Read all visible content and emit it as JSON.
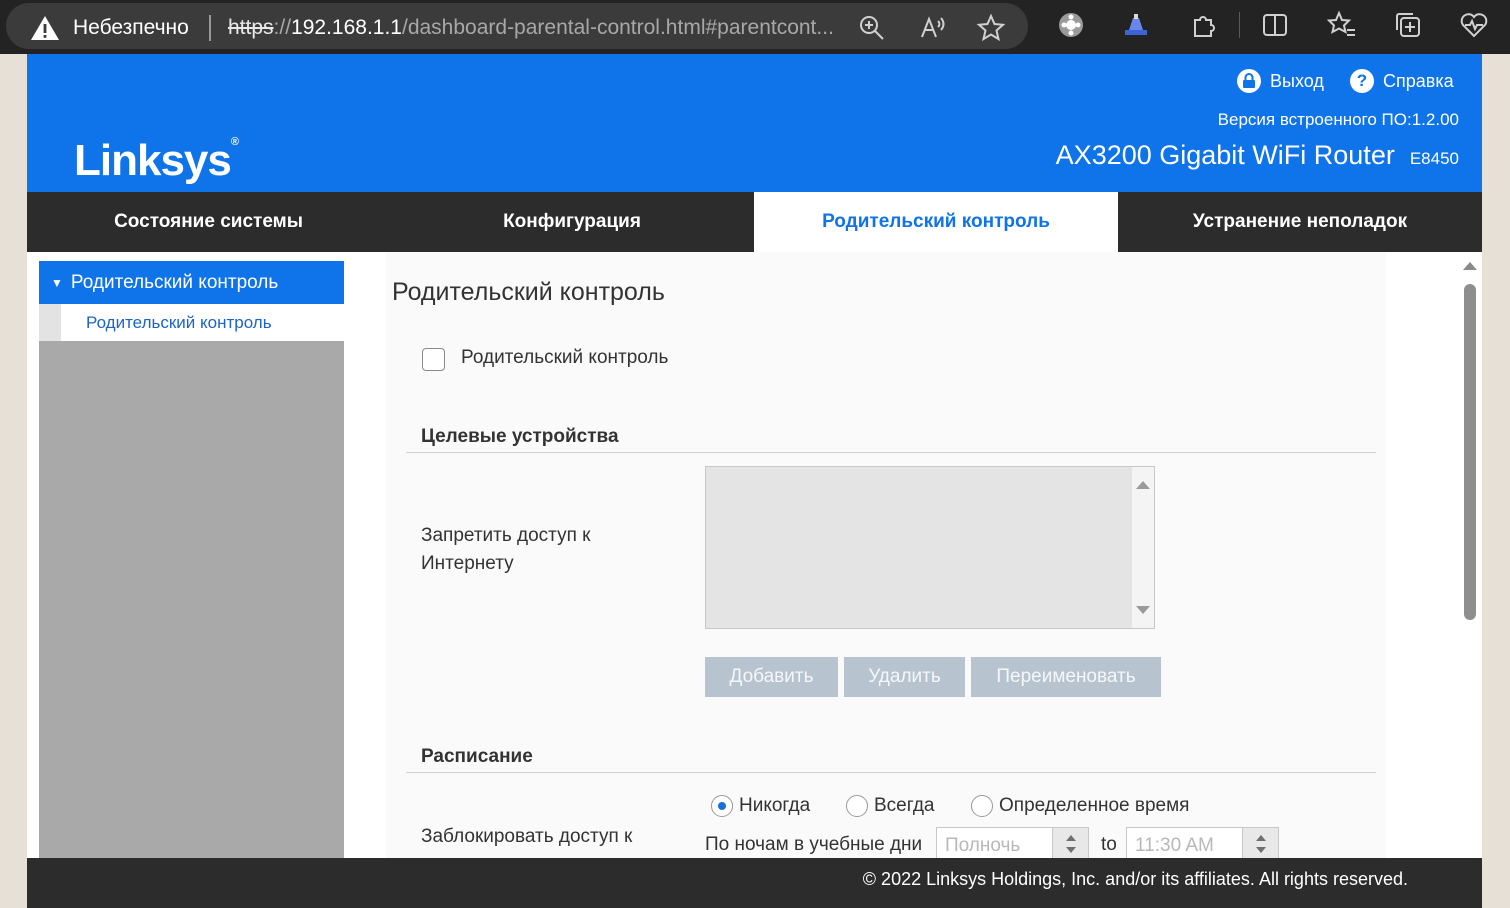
{
  "browser": {
    "security_label": "Небезпечно",
    "url": {
      "protocol": "https",
      "separator": "://",
      "host": "192.168.1.1",
      "path": "/dashboard-parental-control.html#parentcont..."
    },
    "icons": [
      "zoom-icon",
      "read-aloud-icon",
      "favorite-star-icon",
      "extension-puzzle-icon",
      "extension-ship-icon",
      "extensions-icon",
      "split-screen-icon",
      "favorites-icon",
      "collections-icon",
      "browser-health-icon"
    ]
  },
  "header": {
    "logo": "Linksys",
    "logout": "Выход",
    "help": "Справка",
    "firmware_version": "Версия встроенного ПО:1.2.00",
    "model_name": "AX3200 Gigabit WiFi Router",
    "model_code": "E8450"
  },
  "nav": {
    "tabs": [
      {
        "label": "Состояние системы",
        "active": false
      },
      {
        "label": "Конфигурация",
        "active": false
      },
      {
        "label": "Родительский контроль",
        "active": true
      },
      {
        "label": "Устранение неполадок",
        "active": false
      }
    ]
  },
  "sidebar": {
    "section": "Родительский контроль",
    "item": "Родительский контроль"
  },
  "main": {
    "title": "Родительский контроль",
    "enable_checkbox": {
      "label": "Родительский контроль",
      "checked": false
    },
    "target_devices": {
      "heading": "Целевые устройства",
      "deny_label": "Запретить доступ к Интернету",
      "buttons": {
        "add": "Добавить",
        "remove": "Удалить",
        "rename": "Переименовать"
      }
    },
    "schedule": {
      "heading": "Расписание",
      "block_label": "Заблокировать доступ к",
      "options": [
        {
          "label": "Никогда",
          "selected": true
        },
        {
          "label": "Всегда",
          "selected": false
        },
        {
          "label": "Определенное время",
          "selected": false
        }
      ],
      "weeknights_label": "По ночам в учебные дни",
      "from_time": "Полночь",
      "to_label": "to",
      "to_time": "11:30 AM"
    }
  },
  "footer": {
    "copyright": "© 2022 Linksys Holdings, Inc. and/or its affiliates. All rights reserved."
  },
  "colors": {
    "brand_blue": "#0f73ea",
    "nav_dark": "#2c2c2c",
    "button_disabled": "#b7c4d0"
  }
}
